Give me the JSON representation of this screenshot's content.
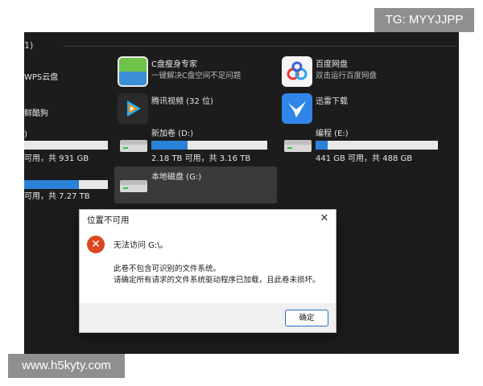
{
  "watermarks": {
    "top_right": "TG: MYYJJPP",
    "bottom_left": "www.h5kyty.com"
  },
  "explorer": {
    "section_header": "1)",
    "apps": [
      {
        "name": "WPS云盘",
        "icon": "wps-cloud-icon"
      },
      {
        "name": "鲜酷狗",
        "icon": "kugou-icon"
      },
      {
        "name": "C盘瘦身专家",
        "desc": "一键解决C盘空间不足问题",
        "icon": "c-drive-cleaner-icon"
      },
      {
        "name": "腾讯视频 (32 位)",
        "icon": "tencent-video-icon"
      },
      {
        "name": "百度网盘",
        "desc": "双击运行百度网盘",
        "icon": "baidu-netdisk-icon"
      },
      {
        "name": "迅雷下载",
        "icon": "xunlei-icon"
      }
    ],
    "drives": [
      {
        "label": "",
        "info": "可用，共 931 GB",
        "used_fraction": 0.0
      },
      {
        "label": "新加卷 (D:)",
        "info": "2.18 TB 可用，共 3.16 TB",
        "used_fraction": 0.31
      },
      {
        "label": "编程 (E:)",
        "info": "441 GB 可用，共 488 GB",
        "used_fraction": 0.1
      },
      {
        "label": "",
        "info": "可用，共 7.27 TB",
        "used_fraction": 0.65
      },
      {
        "label": "本地磁盘 (G:)",
        "info": ""
      }
    ]
  },
  "dialog": {
    "title": "位置不可用",
    "close_glyph": "✕",
    "error_glyph": "✕",
    "message_main": "无法访问 G:\\。",
    "message_detail_1": "此卷不包含可识别的文件系统。",
    "message_detail_2": "请确定所有请求的文件系统驱动程序已加载，且此卷未损坏。",
    "ok_label": "确定"
  },
  "colors": {
    "accent": "#2a82d8",
    "error": "#d9481f",
    "explorer_bg": "#1c1c1c"
  }
}
